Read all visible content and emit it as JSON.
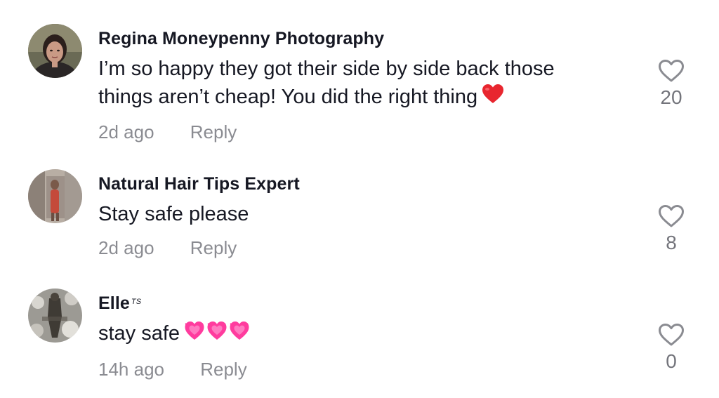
{
  "comments": [
    {
      "username": "Regina Moneypenny Photography",
      "text_line1": "I’m so happy they got their side by side back those",
      "text_line2": "things aren’t cheap! You did the right thing",
      "emoji": "red-heart",
      "time": "2d ago",
      "reply": "Reply",
      "likes": "20"
    },
    {
      "username": "Natural Hair Tips Expert",
      "text": "Stay safe please",
      "time": "2d ago",
      "reply": "Reply",
      "likes": "8"
    },
    {
      "username": "Elle",
      "username_badge": "TS",
      "text": "stay safe",
      "emoji": "pink-hearts x3",
      "time": "14h ago",
      "reply": "Reply",
      "likes": "0"
    }
  ],
  "colors": {
    "username": "#161823",
    "meta": "#8a8b91",
    "heart_outline": "#8a8b91",
    "red_heart": "#e8262f",
    "pink_heart": "#ff3c9e"
  }
}
